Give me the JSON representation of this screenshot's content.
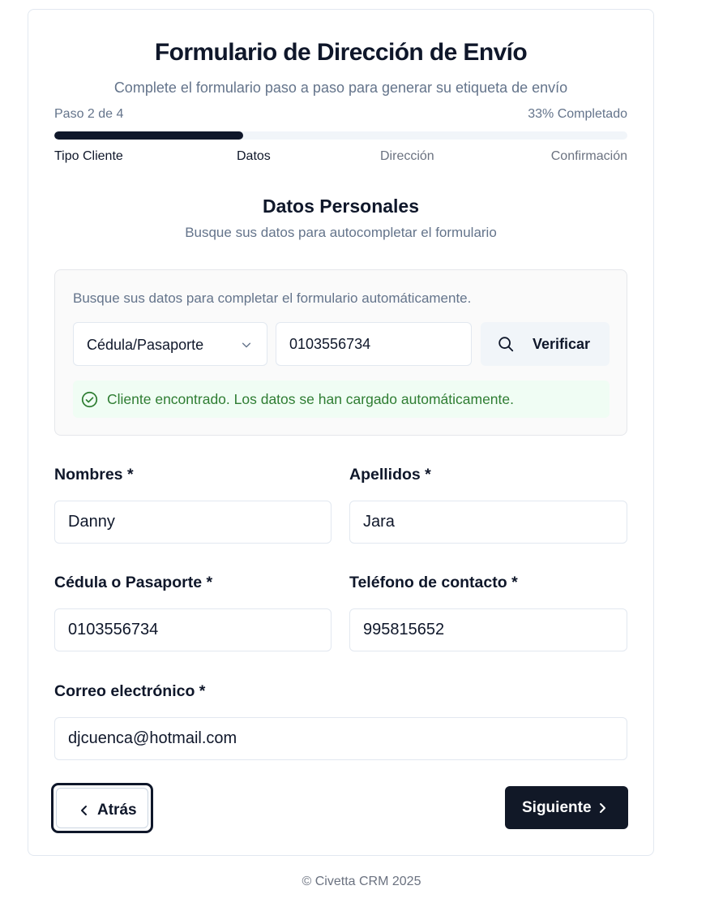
{
  "header": {
    "title": "Formulario de Dirección de Envío",
    "subtitle": "Complete el formulario paso a paso para generar su etiqueta de envío"
  },
  "progress": {
    "step_text": "Paso 2 de 4",
    "percent_text": "33% Completado",
    "fraction": 0.33,
    "steps": [
      "Tipo Cliente",
      "Datos",
      "Dirección",
      "Confirmación"
    ],
    "active_steps": 2
  },
  "section": {
    "title": "Datos Personales",
    "subtitle": "Busque sus datos para autocompletar el formulario"
  },
  "lookup": {
    "hint": "Busque sus datos para completar el formulario automáticamente.",
    "doc_type": "Cédula/Pasaporte",
    "doc_number": "0103556734",
    "verify_label": "Verificar",
    "success_message": "Cliente encontrado. Los datos se han cargado automáticamente."
  },
  "form": {
    "nombres_label": "Nombres *",
    "nombres_value": "Danny",
    "apellidos_label": "Apellidos *",
    "apellidos_value": "Jara",
    "cedula_label": "Cédula o Pasaporte *",
    "cedula_value": "0103556734",
    "telefono_label": "Teléfono de contacto *",
    "telefono_value": "995815652",
    "correo_label": "Correo electrónico *",
    "correo_value": "djcuenca@hotmail.com"
  },
  "nav": {
    "back_label": "Atrás",
    "next_label": "Siguiente"
  },
  "footer": {
    "text": "© Civetta CRM 2025"
  },
  "colors": {
    "primary": "#0f172a",
    "success_text": "#2e7d32",
    "success_bg": "#f0fdf4"
  }
}
